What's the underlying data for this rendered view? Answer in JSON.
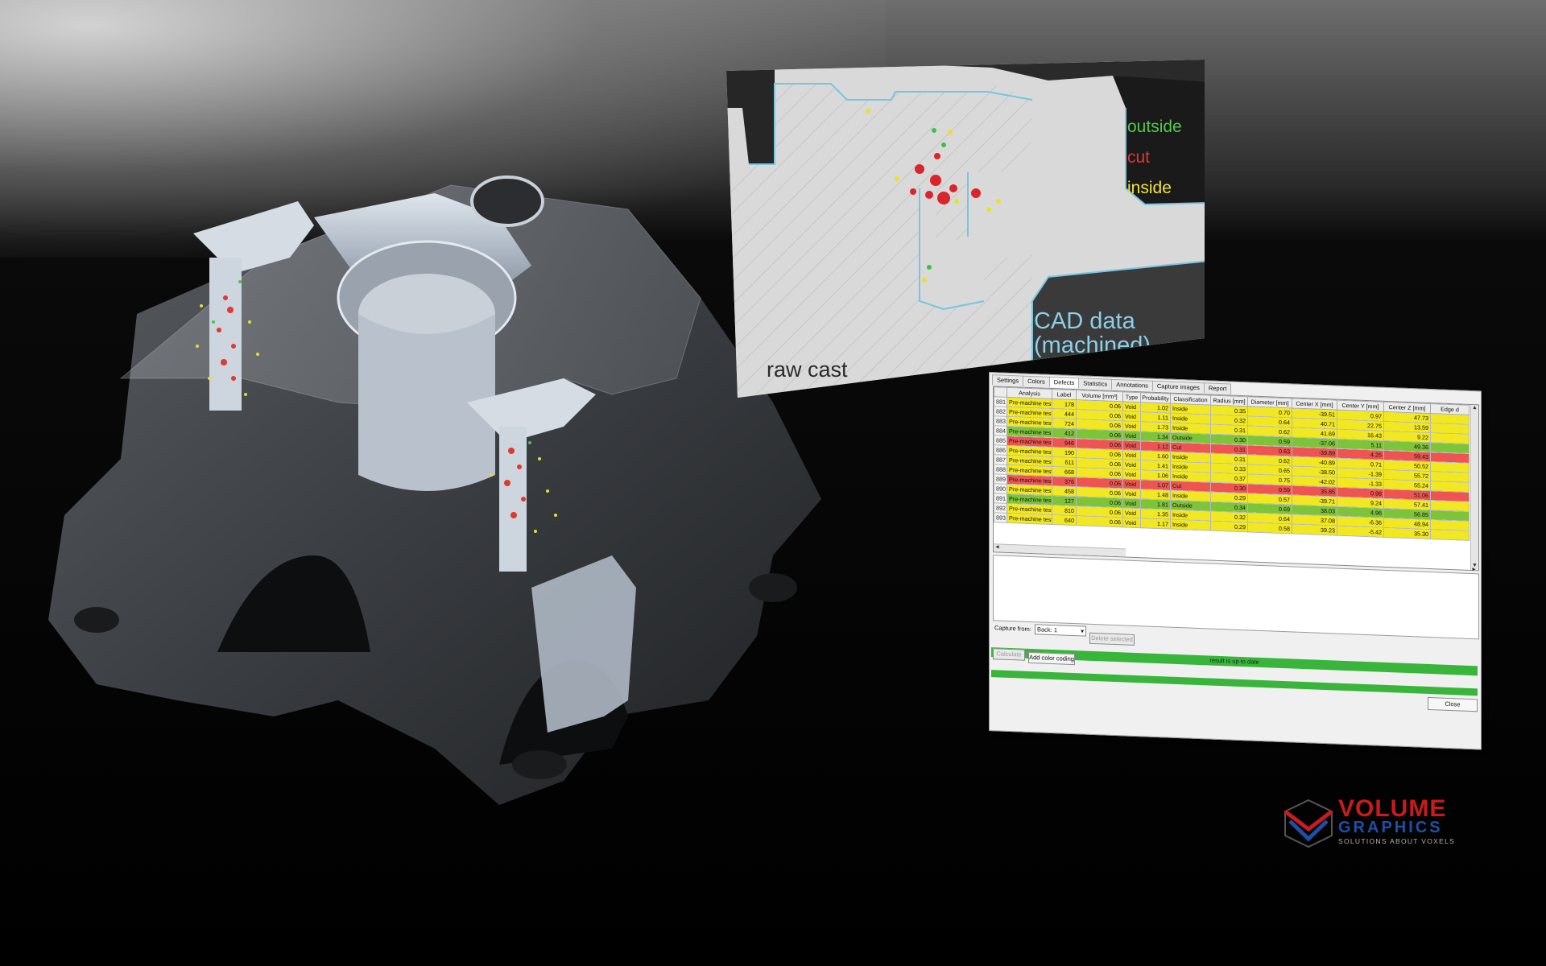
{
  "slice": {
    "legend": {
      "outside": "outside",
      "cut": "cut",
      "inside": "inside"
    },
    "label_raw": "raw cast",
    "label_cad_line1": "CAD data",
    "label_cad_line2": "(machined)"
  },
  "window": {
    "tabs": [
      "Settings",
      "Colors",
      "Defects",
      "Statistics",
      "Annotations",
      "Capture images",
      "Report"
    ],
    "active_tab": "Defects",
    "columns": [
      "",
      "Analysis",
      "Label",
      "Volume [mm³]",
      "Type",
      "Probability",
      "Classification",
      "Radius [mm]",
      "Diameter [mm]",
      "Center X [mm]",
      "Center Y [mm]",
      "Center Z [mm]",
      "Edge d"
    ],
    "rows": [
      {
        "id": "881",
        "analysis": "Pre-machine test",
        "label": "178",
        "volume": "0.06",
        "type": "Void",
        "prob": "1.02",
        "class": "Inside",
        "radius": "0.35",
        "diam": "0.70",
        "cx": "-39.51",
        "cy": "0.97",
        "cz": "47.73",
        "status": "inside"
      },
      {
        "id": "882",
        "analysis": "Pre-machine test",
        "label": "444",
        "volume": "0.06",
        "type": "Void",
        "prob": "1.11",
        "class": "Inside",
        "radius": "0.32",
        "diam": "0.64",
        "cx": "40.71",
        "cy": "22.75",
        "cz": "13.59",
        "status": "inside"
      },
      {
        "id": "883",
        "analysis": "Pre-machine test",
        "label": "724",
        "volume": "0.06",
        "type": "Void",
        "prob": "1.73",
        "class": "Inside",
        "radius": "0.31",
        "diam": "0.62",
        "cx": "41.69",
        "cy": "16.43",
        "cz": "9.22",
        "status": "inside"
      },
      {
        "id": "884",
        "analysis": "Pre-machine test",
        "label": "412",
        "volume": "0.06",
        "type": "Void",
        "prob": "1.34",
        "class": "Outside",
        "radius": "0.30",
        "diam": "0.59",
        "cx": "-37.06",
        "cy": "5.11",
        "cz": "49.36",
        "status": "outside"
      },
      {
        "id": "885",
        "analysis": "Pre-machine test",
        "label": "946",
        "volume": "0.06",
        "type": "Void",
        "prob": "1.12",
        "class": "Cut",
        "radius": "0.31",
        "diam": "0.63",
        "cx": "-39.89",
        "cy": "4.25",
        "cz": "59.43",
        "status": "cut"
      },
      {
        "id": "886",
        "analysis": "Pre-machine test",
        "label": "190",
        "volume": "0.06",
        "type": "Void",
        "prob": "1.60",
        "class": "Inside",
        "radius": "0.31",
        "diam": "0.62",
        "cx": "-40.89",
        "cy": "0.71",
        "cz": "50.52",
        "status": "inside"
      },
      {
        "id": "887",
        "analysis": "Pre-machine test",
        "label": "611",
        "volume": "0.06",
        "type": "Void",
        "prob": "1.41",
        "class": "Inside",
        "radius": "0.33",
        "diam": "0.65",
        "cx": "-38.50",
        "cy": "-1.39",
        "cz": "55.72",
        "status": "inside"
      },
      {
        "id": "888",
        "analysis": "Pre-machine test",
        "label": "668",
        "volume": "0.06",
        "type": "Void",
        "prob": "1.06",
        "class": "Inside",
        "radius": "0.37",
        "diam": "0.75",
        "cx": "-42.02",
        "cy": "-1.33",
        "cz": "55.24",
        "status": "inside"
      },
      {
        "id": "889",
        "analysis": "Pre-machine test",
        "label": "376",
        "volume": "0.06",
        "type": "Void",
        "prob": "1.07",
        "class": "Cut",
        "radius": "0.30",
        "diam": "0.59",
        "cx": "35.85",
        "cy": "0.98",
        "cz": "51.06",
        "status": "cut"
      },
      {
        "id": "890",
        "analysis": "Pre-machine test",
        "label": "458",
        "volume": "0.06",
        "type": "Void",
        "prob": "1.48",
        "class": "Inside",
        "radius": "0.29",
        "diam": "0.57",
        "cx": "-39.71",
        "cy": "9.24",
        "cz": "57.41",
        "status": "inside"
      },
      {
        "id": "891",
        "analysis": "Pre-machine test",
        "label": "127",
        "volume": "0.06",
        "type": "Void",
        "prob": "1.81",
        "class": "Outside",
        "radius": "0.34",
        "diam": "0.69",
        "cx": "38.03",
        "cy": "4.96",
        "cz": "56.85",
        "status": "outside"
      },
      {
        "id": "892",
        "analysis": "Pre-machine test",
        "label": "810",
        "volume": "0.06",
        "type": "Void",
        "prob": "1.35",
        "class": "Inside",
        "radius": "0.32",
        "diam": "0.64",
        "cx": "37.08",
        "cy": "-6.36",
        "cz": "48.94",
        "status": "inside"
      },
      {
        "id": "893",
        "analysis": "Pre-machine test",
        "label": "640",
        "volume": "0.06",
        "type": "Void",
        "prob": "1.17",
        "class": "Inside",
        "radius": "0.29",
        "diam": "0.58",
        "cx": "39.23",
        "cy": "-5.42",
        "cz": "35.30",
        "status": "inside"
      }
    ],
    "capture_from_label": "Capture from:",
    "capture_from_value": "Back: 1",
    "delete_selected": "Delete selected",
    "calculate": "Calculate",
    "add_color_coding": "Add color coding",
    "status_text": "result is up to date",
    "close": "Close",
    "colors": {
      "inside": "#f2e81f",
      "outside": "#7cc43a",
      "cut": "#ef5452"
    }
  },
  "logo": {
    "line1": "VOLUME",
    "line2": "GRAPHICS",
    "tagline": "SOLUTIONS ABOUT VOXELS"
  }
}
